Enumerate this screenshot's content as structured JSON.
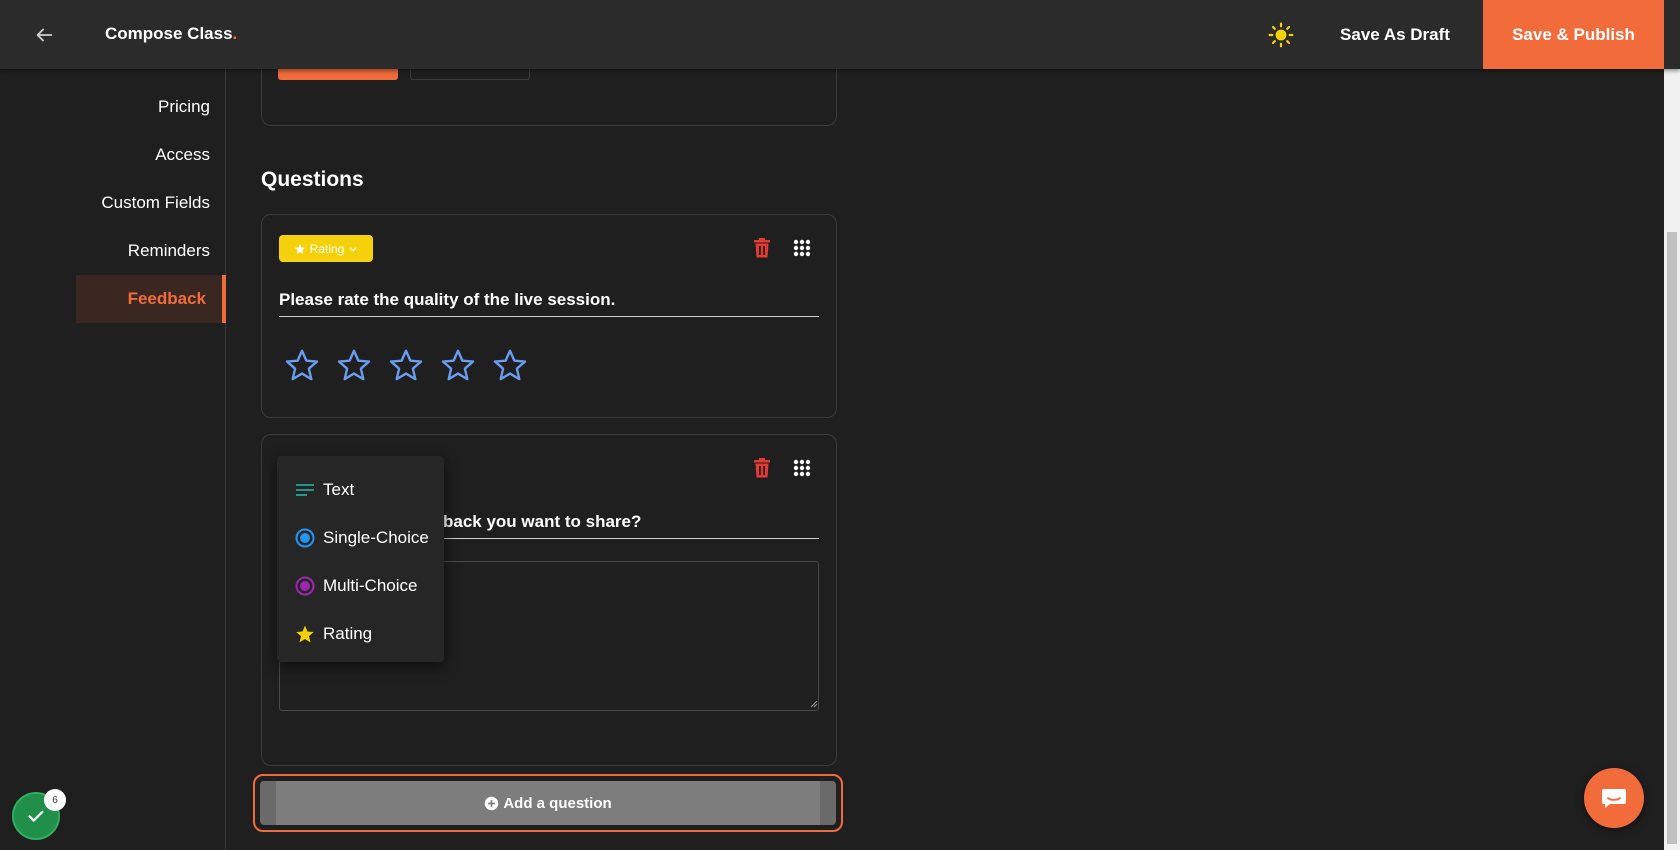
{
  "header": {
    "back_icon": "arrow-left-icon",
    "title": "Compose Class",
    "title_dot": ".",
    "theme_icon": "sun-icon",
    "draft_label": "Save As Draft",
    "publish_label": "Save & Publish"
  },
  "sidebar": {
    "items": [
      {
        "label": "Pricing",
        "active": false
      },
      {
        "label": "Access",
        "active": false
      },
      {
        "label": "Custom Fields",
        "active": false
      },
      {
        "label": "Reminders",
        "active": false
      },
      {
        "label": "Feedback",
        "active": true
      }
    ]
  },
  "main": {
    "section_title": "Questions",
    "questions": [
      {
        "type_label": "Rating",
        "title": "Please rate the quality of the live session.",
        "stars_count": 5,
        "icons": [
          "trash-icon",
          "grid-icon"
        ]
      },
      {
        "title_visible": "back you want to share?",
        "icons": [
          "trash-icon",
          "grid-icon"
        ]
      }
    ],
    "type_menu": [
      {
        "label": "Text",
        "icon": "text-lines-icon"
      },
      {
        "label": "Single-Choice",
        "icon": "radio-icon"
      },
      {
        "label": "Multi-Choice",
        "icon": "radio-icon"
      },
      {
        "label": "Rating",
        "icon": "star-icon"
      }
    ],
    "add_question_label": "Add a question"
  },
  "footer": {
    "checklist_count": "6",
    "chat_icon": "chat-icon"
  },
  "colors": {
    "accent": "#f26b3a",
    "rating_pill": "#f5d10c",
    "star_outline": "#6a9cf0",
    "trash": "#e53935",
    "single_choice": "#2196f3",
    "multi_choice": "#9c27b0",
    "text_icon": "#26a69a"
  }
}
